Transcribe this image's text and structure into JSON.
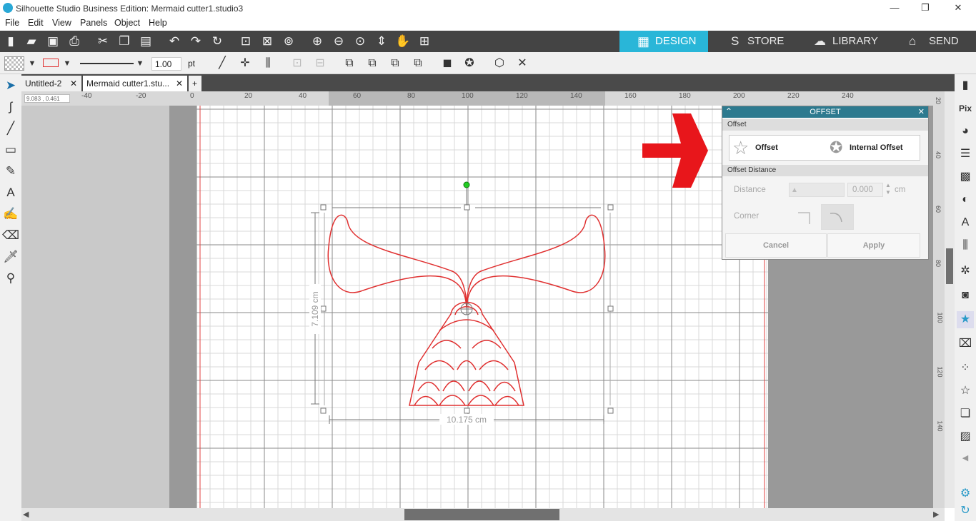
{
  "window": {
    "title": "Silhouette Studio Business Edition: Mermaid cutter1.studio3",
    "min": "—",
    "max": "❐",
    "close": "✕"
  },
  "menu": [
    "File",
    "Edit",
    "View",
    "Panels",
    "Object",
    "Help"
  ],
  "modes": {
    "design": "DESIGN",
    "store": "STORE",
    "library": "LIBRARY",
    "send": "SEND"
  },
  "toolbar2": {
    "line_width": "1.00",
    "unit": "pt"
  },
  "tabs": [
    {
      "label": "Untitled-2",
      "close": "✕"
    },
    {
      "label": "Mermaid cutter1.stu...",
      "close": "✕"
    },
    {
      "label": "+"
    }
  ],
  "ruler": {
    "coord": "9.083 , 0.461",
    "h_ticks": [
      "-40",
      "-20",
      "0",
      "20",
      "40",
      "60",
      "80",
      "100",
      "120",
      "140",
      "160",
      "180",
      "200",
      "220",
      "240"
    ],
    "v_ticks": [
      "20",
      "40",
      "60",
      "80",
      "100",
      "120",
      "140"
    ]
  },
  "selection": {
    "height": "7.109 cm",
    "width": "10.175 cm"
  },
  "offset_panel": {
    "title": "OFFSET",
    "section_offset": "Offset",
    "btn_offset": "Offset",
    "btn_internal": "Internal Offset",
    "section_distance": "Offset Distance",
    "distance_label": "Distance",
    "distance_value": "0.000",
    "distance_unit": "cm",
    "corner_label": "Corner",
    "cancel": "Cancel",
    "apply": "Apply"
  },
  "colors": {
    "accent": "#29b6d8",
    "arrow": "#e8161b",
    "shape": "#e03030"
  }
}
